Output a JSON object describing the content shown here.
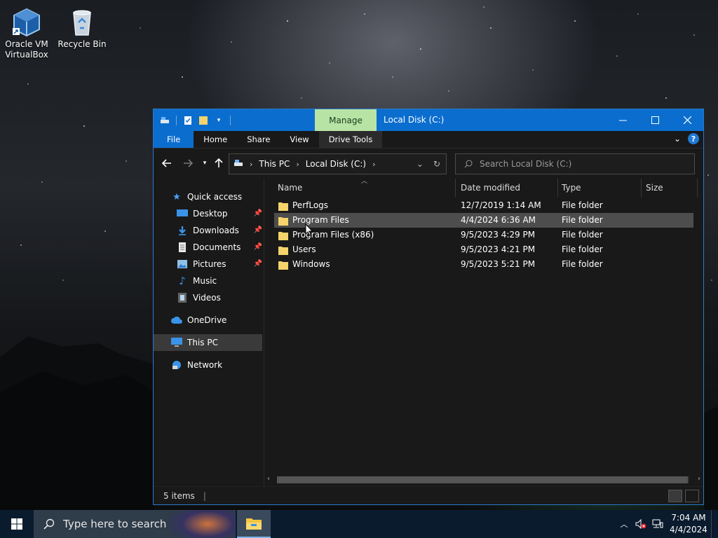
{
  "desktop": {
    "icons": [
      {
        "label_line1": "Oracle VM",
        "label_line2": "VirtualBox",
        "icon": "virtualbox-icon"
      },
      {
        "label_line1": "Recycle Bin",
        "label_line2": "",
        "icon": "recycle-bin-icon"
      }
    ]
  },
  "window": {
    "title": "Local Disk (C:)",
    "contextual_tab": "Manage",
    "ribbon_tabs": [
      "File",
      "Home",
      "Share",
      "View",
      "Drive Tools"
    ],
    "address": {
      "crumbs": [
        "This PC",
        "Local Disk (C:)"
      ]
    },
    "search_placeholder": "Search Local Disk (C:)",
    "columns": {
      "name": "Name",
      "date": "Date modified",
      "type": "Type",
      "size": "Size"
    },
    "files": [
      {
        "name": "PerfLogs",
        "date": "12/7/2019 1:14 AM",
        "type": "File folder",
        "size": ""
      },
      {
        "name": "Program Files",
        "date": "4/4/2024 6:36 AM",
        "type": "File folder",
        "size": ""
      },
      {
        "name": "Program Files (x86)",
        "date": "9/5/2023 4:29 PM",
        "type": "File folder",
        "size": ""
      },
      {
        "name": "Users",
        "date": "9/5/2023 4:21 PM",
        "type": "File folder",
        "size": ""
      },
      {
        "name": "Windows",
        "date": "9/5/2023 5:21 PM",
        "type": "File folder",
        "size": ""
      }
    ],
    "nav": {
      "quick_access": "Quick access",
      "items": [
        {
          "label": "Desktop",
          "pinned": true
        },
        {
          "label": "Downloads",
          "pinned": true
        },
        {
          "label": "Documents",
          "pinned": true
        },
        {
          "label": "Pictures",
          "pinned": true
        },
        {
          "label": "Music",
          "pinned": false
        },
        {
          "label": "Videos",
          "pinned": false
        }
      ],
      "onedrive": "OneDrive",
      "this_pc": "This PC",
      "network": "Network"
    },
    "status": "5 items"
  },
  "taskbar": {
    "search_placeholder": "Type here to search",
    "time": "7:04 AM",
    "date": "4/4/2024"
  },
  "colors": {
    "accent": "#0b6ecf",
    "manage_tab": "#b7e4a4",
    "folder": "#f4d46b",
    "taskbar": "#0b1b2e"
  }
}
